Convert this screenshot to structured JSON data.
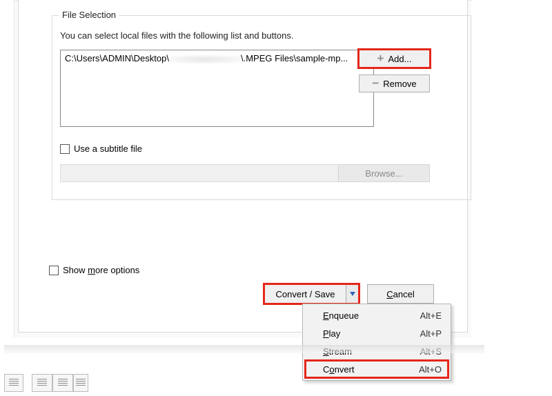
{
  "groupbox": {
    "legend": "File Selection",
    "hint": "You can select local files with the following list and buttons.",
    "file_entry_prefix": "C:\\Users\\ADMIN\\Desktop\\",
    "file_entry_suffix": "\\.MPEG Files\\sample-mp...",
    "add_label": "Add...",
    "remove_label": "Remove",
    "subtitle_checkbox": "Use a subtitle file",
    "browse_label": "Browse..."
  },
  "more_options_label_pre": "Show ",
  "more_options_key": "m",
  "more_options_label_post": "ore options",
  "footer": {
    "convert_label": "Convert / Save",
    "cancel_key": "C",
    "cancel_rest": "ancel"
  },
  "menu": {
    "items": [
      {
        "key": "E",
        "pre": "",
        "post": "nqueue",
        "shortcut": "Alt+E"
      },
      {
        "key": "P",
        "pre": "",
        "post": "lay",
        "shortcut": "Alt+P"
      },
      {
        "key": "S",
        "pre": "",
        "post": "tream",
        "shortcut": "Alt+S"
      },
      {
        "key": "o",
        "pre": "C",
        "post": "nvert",
        "shortcut": "Alt+O"
      }
    ]
  }
}
